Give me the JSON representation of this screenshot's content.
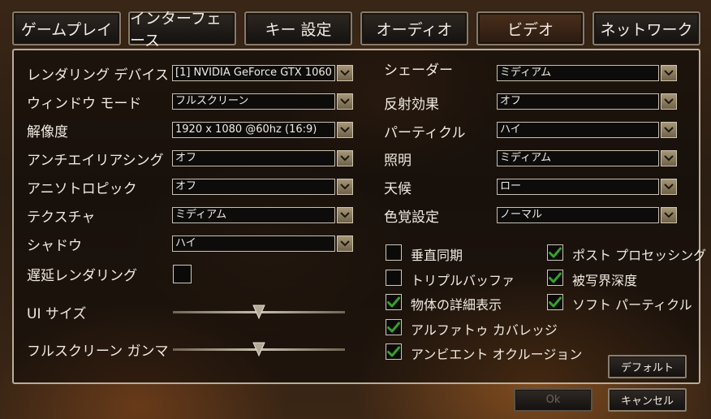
{
  "tabs": [
    {
      "label": "ゲームプレイ"
    },
    {
      "label": "インターフェース"
    },
    {
      "label": "キー 設定"
    },
    {
      "label": "オーディオ"
    },
    {
      "label": "ビデオ",
      "active": true
    },
    {
      "label": "ネットワーク"
    }
  ],
  "left_settings": [
    {
      "label": "レンダリング デバイス",
      "value": "[1] NVIDIA GeForce GTX 1060"
    },
    {
      "label": "ウィンドウ モード",
      "value": "フルスクリーン"
    },
    {
      "label": "解像度",
      "value": "1920 x 1080 @60hz (16:9)"
    },
    {
      "label": "アンチエイリアシング",
      "value": "オフ"
    },
    {
      "label": "アニソトロピック",
      "value": "オフ"
    },
    {
      "label": "テクスチャ",
      "value": "ミディアム"
    },
    {
      "label": "シャドウ",
      "value": "ハイ"
    }
  ],
  "deferred_rendering": {
    "label": "遅延レンダリング",
    "checked": false
  },
  "sliders": {
    "ui_size": {
      "label": "UI サイズ",
      "level": 0.5
    },
    "gamma": {
      "label": "フルスクリーン ガンマ",
      "level": 0.5
    }
  },
  "right_settings": [
    {
      "label": "シェーダー",
      "value": "ミディアム"
    },
    {
      "label": "反射効果",
      "value": "オフ"
    },
    {
      "label": "パーティクル",
      "value": "ハイ"
    },
    {
      "label": "照明",
      "value": "ミディアム"
    },
    {
      "label": "天候",
      "value": "ロー"
    },
    {
      "label": "色覚設定",
      "value": "ノーマル"
    }
  ],
  "checkboxes_left": [
    {
      "label": "垂直同期",
      "checked": false
    },
    {
      "label": "トリプルバッファ",
      "checked": false
    },
    {
      "label": "物体の詳細表示",
      "checked": true
    },
    {
      "label": "アルファトゥ カバレッジ",
      "checked": true
    },
    {
      "label": "アンビエント オクルージョン",
      "checked": true
    }
  ],
  "checkboxes_right": [
    {
      "label": "ポスト プロセッシング",
      "checked": true
    },
    {
      "label": "被写界深度",
      "checked": true
    },
    {
      "label": "ソフト パーティクル",
      "checked": true
    }
  ],
  "buttons": {
    "default": "デフォルト",
    "ok": "Ok",
    "cancel": "キャンセル"
  },
  "colors": {
    "check": "#35a12a",
    "accent": "#b9ad9a"
  }
}
